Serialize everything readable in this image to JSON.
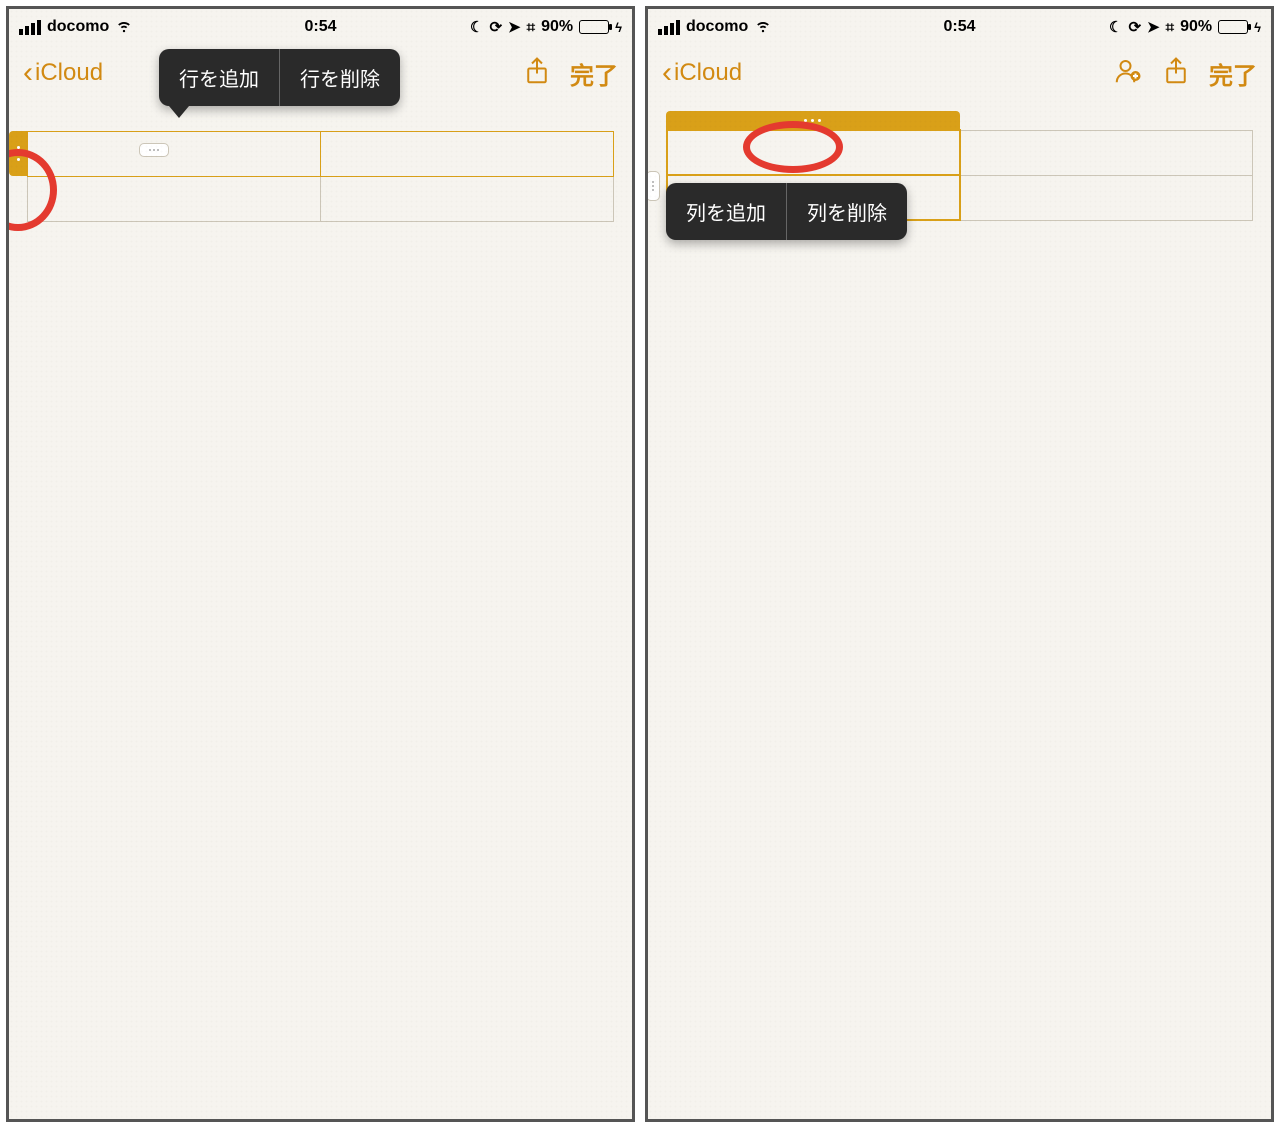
{
  "status": {
    "carrier": "docomo",
    "time": "0:54",
    "battery_pct": "90%"
  },
  "nav": {
    "back_label": "iCloud",
    "done_label": "完了"
  },
  "left": {
    "popover": {
      "add": "行を追加",
      "delete": "行を削除"
    }
  },
  "right": {
    "popover": {
      "add": "列を追加",
      "delete": "列を削除"
    }
  }
}
